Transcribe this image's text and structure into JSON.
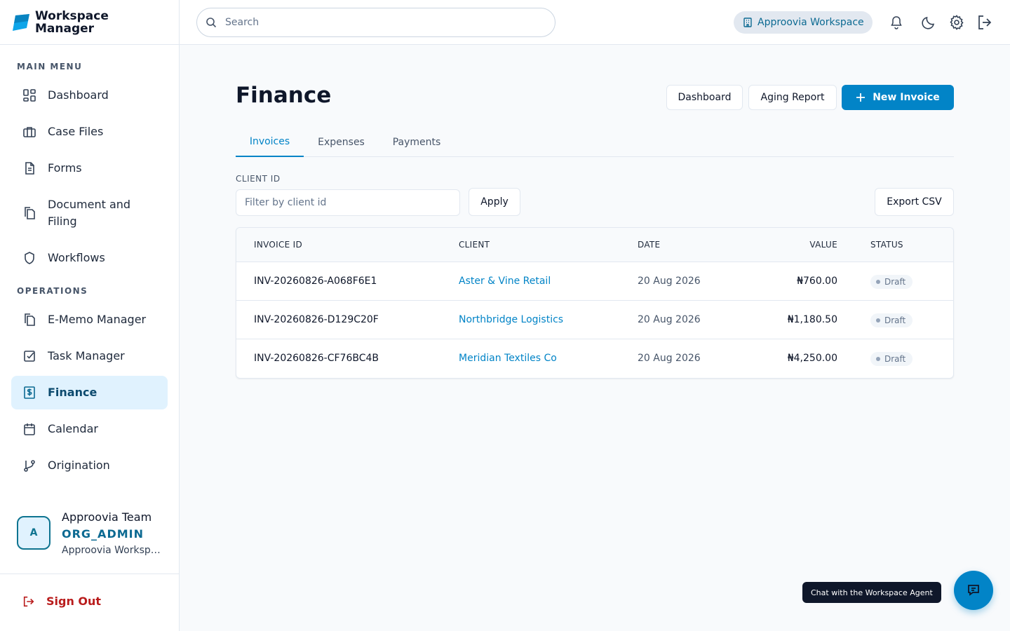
{
  "brand": {
    "name_line1": "Workspace",
    "name_line2": "Manager"
  },
  "sidebar": {
    "sections": [
      "MAIN MENU",
      "OPERATIONS"
    ],
    "main_items": [
      {
        "label": "Dashboard",
        "icon": "dashboard-icon"
      },
      {
        "label": "Case Files",
        "icon": "briefcase-icon"
      },
      {
        "label": "Forms",
        "icon": "document-icon"
      },
      {
        "label": "Document and",
        "label2": "Filing",
        "icon": "copy-icon"
      },
      {
        "label": "Workflows",
        "icon": "shield-icon"
      }
    ],
    "ops_items": [
      {
        "label": "E-Memo Manager",
        "icon": "copy-icon"
      },
      {
        "label": "Task Manager",
        "icon": "checkbox-icon"
      },
      {
        "label": "Finance",
        "icon": "dollar-file-icon",
        "active": true
      },
      {
        "label": "Calendar",
        "icon": "calendar-icon"
      },
      {
        "label": "Origination",
        "icon": "git-branch-icon"
      }
    ],
    "user": {
      "initial": "A",
      "name": "Approovia Team",
      "role": "ORG_ADMIN",
      "workspace": "Approovia Workspace"
    },
    "signout_label": "Sign Out"
  },
  "topbar": {
    "search_placeholder": "Search",
    "workspace_label": "Approovia Workspace"
  },
  "page": {
    "title": "Finance",
    "buttons": {
      "dashboard": "Dashboard",
      "aging": "Aging Report",
      "new_invoice": "New Invoice"
    },
    "tabs": [
      "Invoices",
      "Expenses",
      "Payments"
    ],
    "active_tab": "Invoices",
    "filter": {
      "label": "CLIENT ID",
      "placeholder": "Filter by client id",
      "apply": "Apply",
      "export": "Export CSV"
    }
  },
  "table": {
    "headers": [
      "INVOICE ID",
      "CLIENT",
      "DATE",
      "VALUE",
      "STATUS"
    ],
    "rows": [
      {
        "id": "INV-20260826-A068F6E1",
        "client": "Aster & Vine Retail",
        "date": "20 Aug 2026",
        "value": "₦760.00",
        "status": "Draft"
      },
      {
        "id": "INV-20260826-D129C20F",
        "client": "Northbridge Logistics",
        "date": "20 Aug 2026",
        "value": "₦1,180.50",
        "status": "Draft"
      },
      {
        "id": "INV-20260826-CF76BC4B",
        "client": "Meridian Textiles Co",
        "date": "20 Aug 2026",
        "value": "₦4,250.00",
        "status": "Draft"
      }
    ]
  },
  "chat": {
    "tooltip": "Chat with the Workspace Agent"
  },
  "colors": {
    "accent": "#0284c7",
    "active_bg": "#e0f2fe",
    "danger": "#b91c1c",
    "dark": "#0f172a"
  }
}
